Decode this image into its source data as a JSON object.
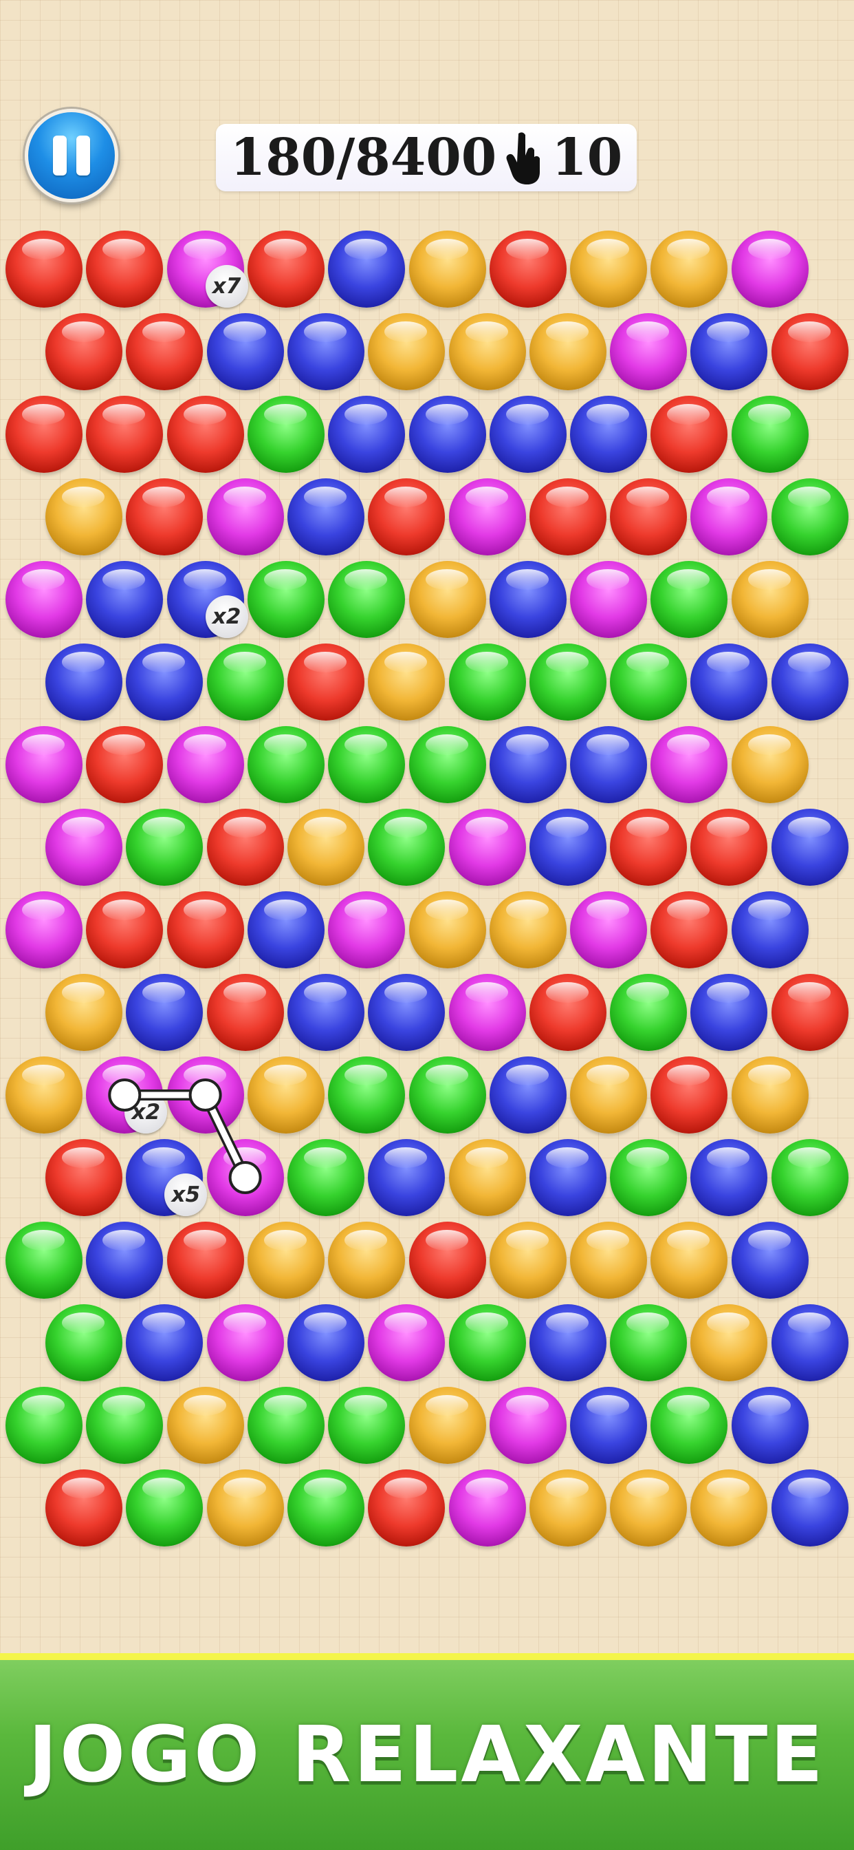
{
  "hud": {
    "pause_icon": "pause-icon",
    "score_text": "180/8400",
    "hand_icon": "pointing-hand-icon",
    "moves_text": "10"
  },
  "colors": {
    "R": "red",
    "B": "blue",
    "G": "green",
    "Y": "yellow",
    "P": "purple"
  },
  "board": {
    "rows": [
      "RRPRBYRYYP",
      "RRBBYYYPBR",
      "RRRGBBBBRG",
      "YRPBRPRRPG",
      "PBBGGYBPGY",
      "BBGRYGGGBB",
      "PRPGGGBBPY",
      "PGRYGPBRRB",
      "PRRBPYYPRB",
      "YBRBBPRGBR",
      "YPPYGGBYRY",
      "RBPGBYBGBG",
      "GBRYYRYYYB",
      "GBPBPGBGYB",
      "GGYGGYPBGB",
      "RGYGRPYYYB"
    ],
    "multipliers": [
      {
        "row": 0,
        "col": 2,
        "label": "x7"
      },
      {
        "row": 4,
        "col": 2,
        "label": "x2"
      },
      {
        "row": 10,
        "col": 1,
        "label": "x2"
      },
      {
        "row": 11,
        "col": 1,
        "label": "x5"
      }
    ],
    "selected_chain": [
      {
        "row": 10,
        "col": 1
      },
      {
        "row": 10,
        "col": 2
      },
      {
        "row": 11,
        "col": 2
      }
    ]
  },
  "banner": {
    "text": "JOGO RELAXANTE"
  }
}
